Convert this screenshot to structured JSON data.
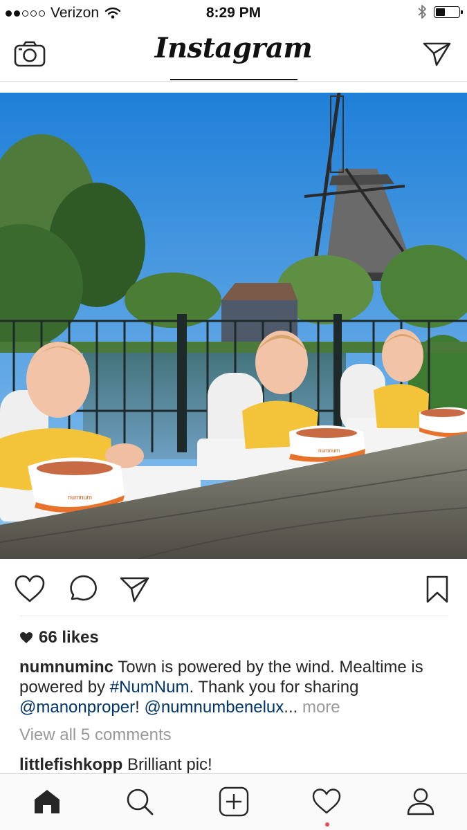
{
  "status": {
    "carrier": "Verizon",
    "time": "8:29 PM"
  },
  "header": {
    "app_title": "Instagram"
  },
  "post": {
    "likes": "66 likes",
    "caption": {
      "username": "numnuminc",
      "text1": "Town is powered by the wind. Mealtime is powered by",
      "hashtag": "#NumNum",
      "text2": ". Thank you for sharing",
      "mention1": "@manonproper",
      "text3": "!",
      "mention2": "@numnumbenelux",
      "ellipsis": "...",
      "more": "more"
    },
    "view_comments": "View all 5 comments",
    "comment": {
      "username": "littlefishkopp",
      "text": "Brilliant pic!"
    },
    "photo_brand": "numnum"
  },
  "colors": {
    "link": "#003569",
    "muted": "#999999",
    "notification": "#ed4956"
  },
  "icons": {
    "header_left": "camera-icon",
    "header_right": "direct-message-icon",
    "actions": [
      "heart-icon",
      "comment-icon",
      "share-icon",
      "bookmark-icon"
    ],
    "tabs": [
      "home-icon",
      "search-icon",
      "add-post-icon",
      "activity-heart-icon",
      "profile-icon"
    ]
  }
}
